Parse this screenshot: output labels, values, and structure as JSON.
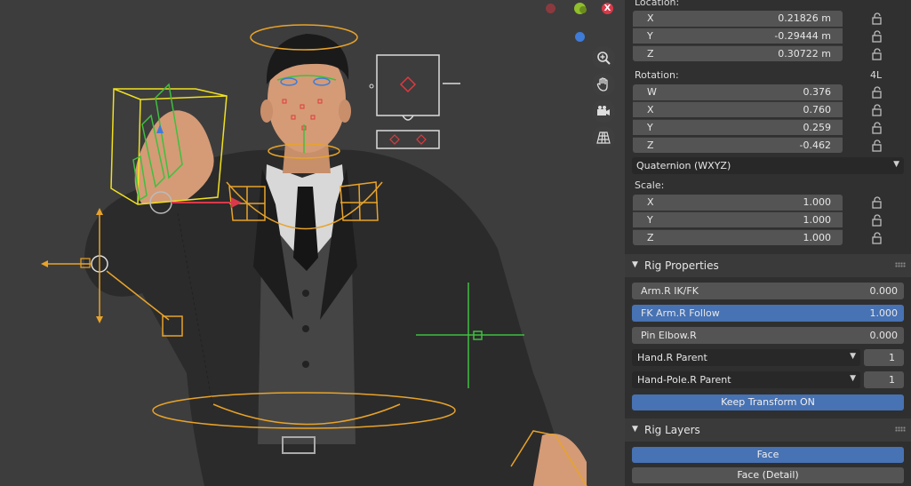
{
  "transform": {
    "location_label": "Location:",
    "location": [
      {
        "axis": "X",
        "value": "0.21826 m"
      },
      {
        "axis": "Y",
        "value": "-0.29444 m"
      },
      {
        "axis": "Z",
        "value": "0.30722 m"
      }
    ],
    "rotation_label": "Rotation:",
    "rotation_mode_short": "4L",
    "rotation": [
      {
        "axis": "W",
        "value": "0.376"
      },
      {
        "axis": "X",
        "value": "0.760"
      },
      {
        "axis": "Y",
        "value": "0.259"
      },
      {
        "axis": "Z",
        "value": "-0.462"
      }
    ],
    "rotation_mode": "Quaternion (WXYZ)",
    "scale_label": "Scale:",
    "scale": [
      {
        "axis": "X",
        "value": "1.000"
      },
      {
        "axis": "Y",
        "value": "1.000"
      },
      {
        "axis": "Z",
        "value": "1.000"
      }
    ]
  },
  "rig_properties": {
    "title": "Rig Properties",
    "ik_fk": {
      "label": "Arm.R IK/FK",
      "value": "0.000"
    },
    "fk_follow": {
      "label": "FK Arm.R Follow",
      "value": "1.000"
    },
    "pin_elbow": {
      "label": "Pin Elbow.R",
      "value": "0.000"
    },
    "hand_parent": {
      "label": "Hand.R Parent",
      "value": "1"
    },
    "hand_pole_parent": {
      "label": "Hand-Pole.R Parent",
      "value": "1"
    },
    "keep_transform": "Keep Transform ON"
  },
  "rig_layers": {
    "title": "Rig Layers",
    "face": "Face",
    "face_detail": "Face (Detail)"
  },
  "gizmo": {
    "x_label": "X"
  },
  "colors": {
    "accent_blue": "#4772b3",
    "bone_yellow": "#e8a32a",
    "bone_green": "#3fbf3f",
    "selected_yellow": "#f0e020"
  }
}
